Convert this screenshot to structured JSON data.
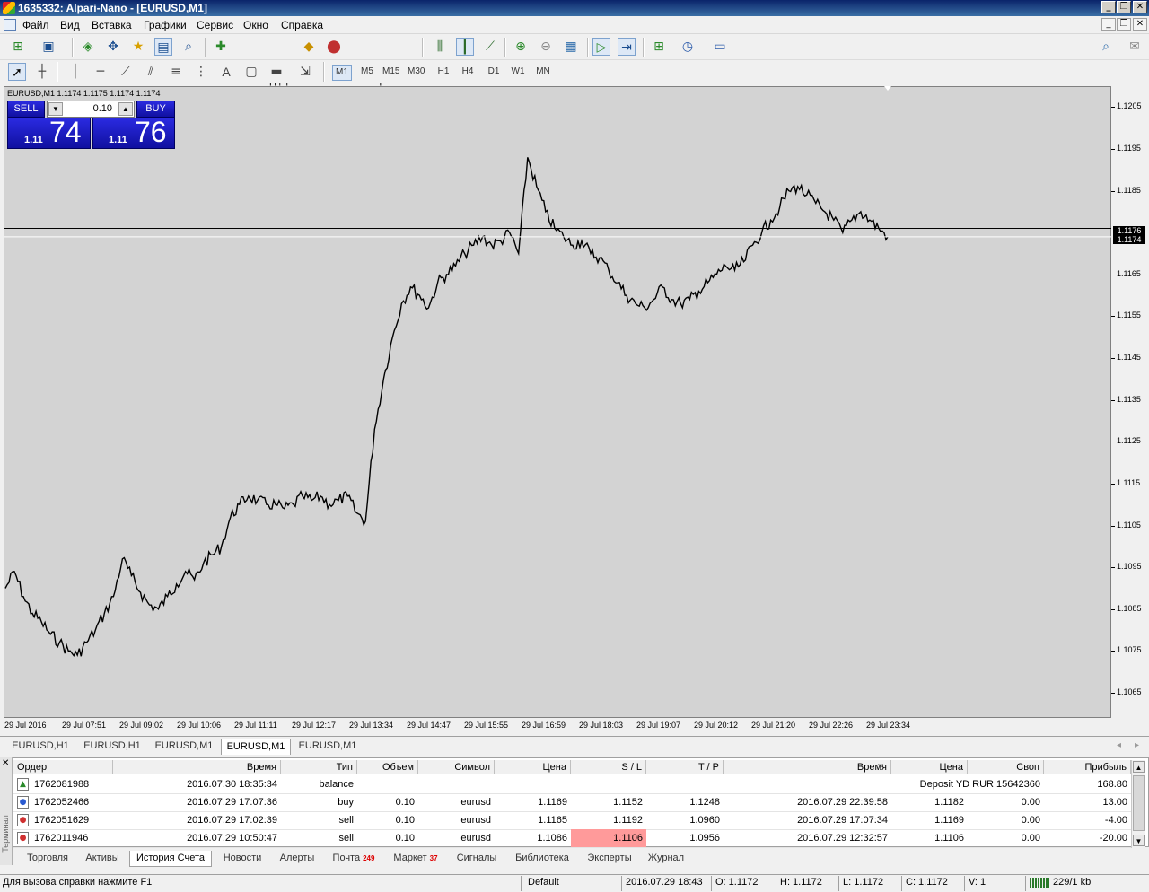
{
  "window": {
    "title": "1635332: Alpari-Nano - [EURUSD,M1]"
  },
  "menu": [
    "Файл",
    "Вид",
    "Вставка",
    "Графики",
    "Сервис",
    "Окно",
    "Справка"
  ],
  "toolbar": {
    "new_order": "Новый ордер",
    "auto_trading": "Авто-торговля"
  },
  "toolbar2": {
    "text_tool": "A"
  },
  "timeframes": [
    {
      "label": "M1",
      "active": true
    },
    {
      "label": "M5",
      "active": false
    },
    {
      "label": "M15",
      "active": false
    },
    {
      "label": "M30",
      "active": false
    },
    {
      "label": "H1",
      "active": false
    },
    {
      "label": "H4",
      "active": false
    },
    {
      "label": "D1",
      "active": false
    },
    {
      "label": "W1",
      "active": false
    },
    {
      "label": "MN",
      "active": false
    }
  ],
  "chart": {
    "caption": "EURUSD,M1  1.1174 1.1175 1.1174 1.1174",
    "bid_label": "1.1174",
    "ask_label": "1.1176"
  },
  "one_click": {
    "sell_label": "SELL",
    "buy_label": "BUY",
    "volume": "0.10",
    "sell_small": "1.11",
    "sell_big": "74",
    "buy_small": "1.11",
    "buy_big": "76"
  },
  "chart_data": {
    "type": "line",
    "title": "EURUSD,M1",
    "xlabel": "",
    "ylabel": "",
    "x_ticks": [
      "29 Jul 2016",
      "29 Jul 07:51",
      "29 Jul 09:02",
      "29 Jul 10:06",
      "29 Jul 11:11",
      "29 Jul 12:17",
      "29 Jul 13:34",
      "29 Jul 14:47",
      "29 Jul 15:55",
      "29 Jul 16:59",
      "29 Jul 18:03",
      "29 Jul 19:07",
      "29 Jul 20:12",
      "29 Jul 21:20",
      "29 Jul 22:26",
      "29 Jul 23:34"
    ],
    "y_ticks": [
      "1.1205",
      "1.1195",
      "1.1185",
      "1.1176",
      "1.1165",
      "1.1155",
      "1.1145",
      "1.1135",
      "1.1125",
      "1.1115",
      "1.1105",
      "1.1095",
      "1.1085",
      "1.1075",
      "1.1065"
    ],
    "ylim": [
      1.1059,
      1.121
    ],
    "grid": false,
    "series": [
      {
        "name": "",
        "values": [
          1.109,
          1.1094,
          1.1088,
          1.1084,
          1.1082,
          1.1079,
          1.1077,
          1.1075,
          1.1074,
          1.1077,
          1.108,
          1.1084,
          1.1088,
          1.1097,
          1.1093,
          1.1089,
          1.1086,
          1.1085,
          1.1088,
          1.1091,
          1.1094,
          1.1092,
          1.1096,
          1.1098,
          1.11,
          1.1107,
          1.111,
          1.1112,
          1.1111,
          1.111,
          1.111,
          1.1109,
          1.111,
          1.1112,
          1.1111,
          1.1112,
          1.111,
          1.1111,
          1.1112,
          1.1108,
          1.1106,
          1.1128,
          1.114,
          1.115,
          1.1158,
          1.1162,
          1.116,
          1.1157,
          1.1163,
          1.1165,
          1.1167,
          1.117,
          1.1172,
          1.1174,
          1.1172,
          1.1173,
          1.1175,
          1.117,
          1.1193,
          1.1186,
          1.118,
          1.1176,
          1.1174,
          1.1172,
          1.1173,
          1.117,
          1.1169,
          1.1166,
          1.1163,
          1.116,
          1.1158,
          1.1157,
          1.1159,
          1.1162,
          1.1159,
          1.1158,
          1.1159,
          1.1161,
          1.1163,
          1.1165,
          1.1167,
          1.1166,
          1.1168,
          1.1172,
          1.1175,
          1.1178,
          1.1181,
          1.1185,
          1.1186,
          1.1184,
          1.1182,
          1.118,
          1.1178,
          1.1175,
          1.1178,
          1.118,
          1.1178,
          1.1176,
          1.1174
        ]
      }
    ]
  },
  "chart_tabs": [
    {
      "label": "EURUSD,H1",
      "active": false
    },
    {
      "label": "EURUSD,H1",
      "active": false
    },
    {
      "label": "EURUSD,M1",
      "active": false
    },
    {
      "label": "EURUSD,M1",
      "active": true
    },
    {
      "label": "EURUSD,M1",
      "active": false
    }
  ],
  "terminal": {
    "side_label": "Терминал",
    "columns": [
      "Ордер",
      "Время",
      "Тип",
      "Объем",
      "Символ",
      "Цена",
      "S / L",
      "T / P",
      "Время",
      "Цена",
      "Своп",
      "Прибыль"
    ],
    "rows": [
      {
        "icon": "balance-icon",
        "order": "1762081988",
        "time": "2016.07.30 18:35:34",
        "type": "balance",
        "comment": "Deposit YD RUR 15642360",
        "profit": "168.80"
      },
      {
        "icon": "buy-order-icon",
        "order": "1762052466",
        "time": "2016.07.29 17:07:36",
        "type": "buy",
        "volume": "0.10",
        "symbol": "eurusd",
        "price": "1.1169",
        "sl": "1.1152",
        "tp": "1.1248",
        "close_time": "2016.07.29 22:39:58",
        "close_price": "1.1182",
        "swap": "0.00",
        "profit": "13.00"
      },
      {
        "icon": "sell-order-icon",
        "order": "1762051629",
        "time": "2016.07.29 17:02:39",
        "type": "sell",
        "volume": "0.10",
        "symbol": "eurusd",
        "price": "1.1165",
        "sl": "1.1192",
        "tp": "1.0960",
        "close_time": "2016.07.29 17:07:34",
        "close_price": "1.1169",
        "swap": "0.00",
        "profit": "-4.00"
      },
      {
        "icon": "sell-order-icon",
        "order": "1762011946",
        "time": "2016.07.29 10:50:47",
        "type": "sell",
        "volume": "0.10",
        "symbol": "eurusd",
        "price": "1.1086",
        "sl": "1.1106",
        "tp": "1.0956",
        "close_time": "2016.07.29 12:32:57",
        "close_price": "1.1106",
        "swap": "0.00",
        "profit": "-20.00"
      }
    ],
    "sl_highlight_color": "#ff9a9a"
  },
  "terminal_tabs": [
    {
      "label": "Торговля",
      "active": false,
      "badge": ""
    },
    {
      "label": "Активы",
      "active": false,
      "badge": ""
    },
    {
      "label": "История Счета",
      "active": true,
      "badge": ""
    },
    {
      "label": "Новости",
      "active": false,
      "badge": ""
    },
    {
      "label": "Алерты",
      "active": false,
      "badge": ""
    },
    {
      "label": "Почта",
      "active": false,
      "badge": "249"
    },
    {
      "label": "Маркет",
      "active": false,
      "badge": "37"
    },
    {
      "label": "Сигналы",
      "active": false,
      "badge": ""
    },
    {
      "label": "Библиотека",
      "active": false,
      "badge": ""
    },
    {
      "label": "Эксперты",
      "active": false,
      "badge": ""
    },
    {
      "label": "Журнал",
      "active": false,
      "badge": ""
    }
  ],
  "status": {
    "help": "Для вызова справки нажмите F1",
    "profile": "Default",
    "datetime": "2016.07.29 18:43",
    "open": "O: 1.1172",
    "high": "H: 1.1172",
    "low": "L: 1.1172",
    "close": "C: 1.1172",
    "volume": "V: 1",
    "traffic": "229/1 kb"
  }
}
